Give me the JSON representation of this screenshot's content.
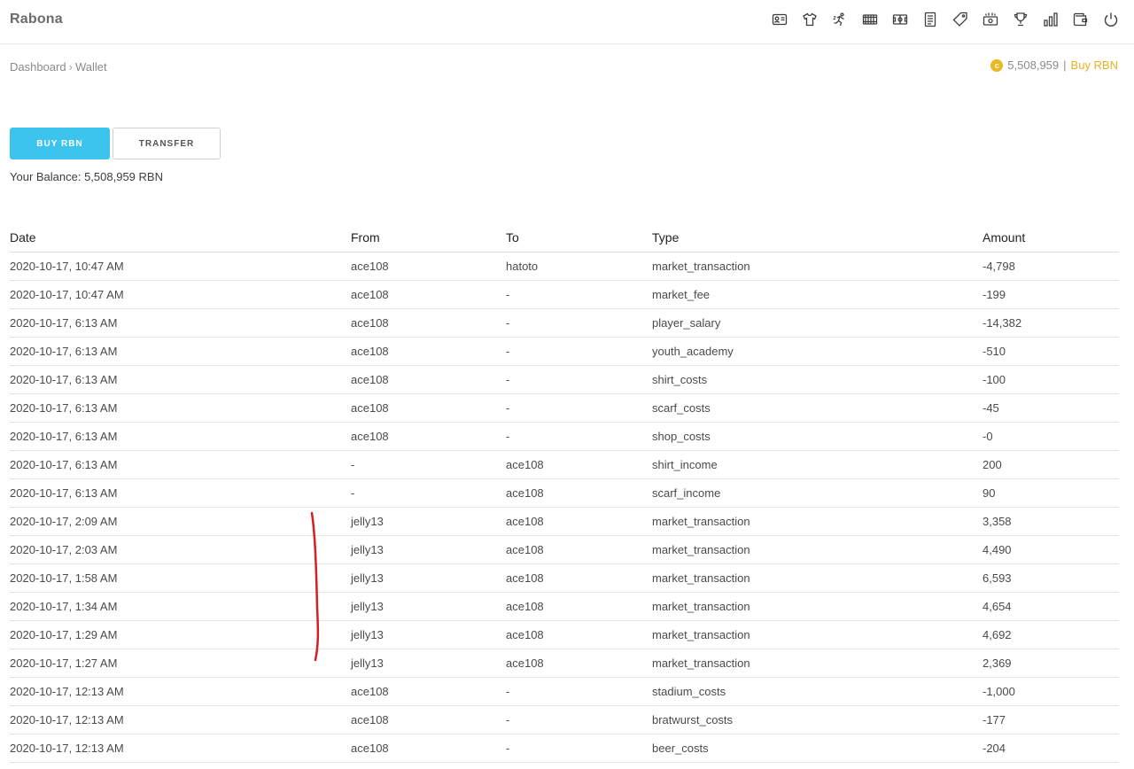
{
  "header": {
    "brand": "Rabona",
    "nav_icons": [
      "id-card-icon",
      "shirt-icon",
      "running-player-icon",
      "stadium-icon",
      "ticket-icon",
      "document-icon",
      "tag-icon",
      "money-icon",
      "trophy-icon",
      "bar-chart-icon",
      "wallet-icon",
      "power-icon"
    ]
  },
  "breadcrumb": {
    "items": [
      "Dashboard",
      "Wallet"
    ],
    "separator": "›"
  },
  "top_balance": {
    "coin_symbol": "c",
    "amount": "5,508,959",
    "divider": "|",
    "buy_label": "Buy RBN"
  },
  "actions": {
    "buy_label": "BUY RBN",
    "transfer_label": "TRANSFER"
  },
  "balance_text": "Your Balance: 5,508,959 RBN",
  "table": {
    "columns": [
      "Date",
      "From",
      "To",
      "Type",
      "Amount"
    ],
    "rows": [
      [
        "2020-10-17, 10:47 AM",
        "ace108",
        "hatoto",
        "market_transaction",
        "-4,798"
      ],
      [
        "2020-10-17, 10:47 AM",
        "ace108",
        "-",
        "market_fee",
        "-199"
      ],
      [
        "2020-10-17, 6:13 AM",
        "ace108",
        "-",
        "player_salary",
        "-14,382"
      ],
      [
        "2020-10-17, 6:13 AM",
        "ace108",
        "-",
        "youth_academy",
        "-510"
      ],
      [
        "2020-10-17, 6:13 AM",
        "ace108",
        "-",
        "shirt_costs",
        "-100"
      ],
      [
        "2020-10-17, 6:13 AM",
        "ace108",
        "-",
        "scarf_costs",
        "-45"
      ],
      [
        "2020-10-17, 6:13 AM",
        "ace108",
        "-",
        "shop_costs",
        "-0"
      ],
      [
        "2020-10-17, 6:13 AM",
        "-",
        "ace108",
        "shirt_income",
        "200"
      ],
      [
        "2020-10-17, 6:13 AM",
        "-",
        "ace108",
        "scarf_income",
        "90"
      ],
      [
        "2020-10-17, 2:09 AM",
        "jelly13",
        "ace108",
        "market_transaction",
        "3,358"
      ],
      [
        "2020-10-17, 2:03 AM",
        "jelly13",
        "ace108",
        "market_transaction",
        "4,490"
      ],
      [
        "2020-10-17, 1:58 AM",
        "jelly13",
        "ace108",
        "market_transaction",
        "6,593"
      ],
      [
        "2020-10-17, 1:34 AM",
        "jelly13",
        "ace108",
        "market_transaction",
        "4,654"
      ],
      [
        "2020-10-17, 1:29 AM",
        "jelly13",
        "ace108",
        "market_transaction",
        "4,692"
      ],
      [
        "2020-10-17, 1:27 AM",
        "jelly13",
        "ace108",
        "market_transaction",
        "2,369"
      ],
      [
        "2020-10-17, 12:13 AM",
        "ace108",
        "-",
        "stadium_costs",
        "-1,000"
      ],
      [
        "2020-10-17, 12:13 AM",
        "ace108",
        "-",
        "bratwurst_costs",
        "-177"
      ],
      [
        "2020-10-17, 12:13 AM",
        "ace108",
        "-",
        "beer_costs",
        "-204"
      ]
    ]
  },
  "colors": {
    "accent": "#3cc3ee",
    "coin": "#e9b824",
    "buy_link": "#e6b023",
    "annotation": "#d42020"
  }
}
